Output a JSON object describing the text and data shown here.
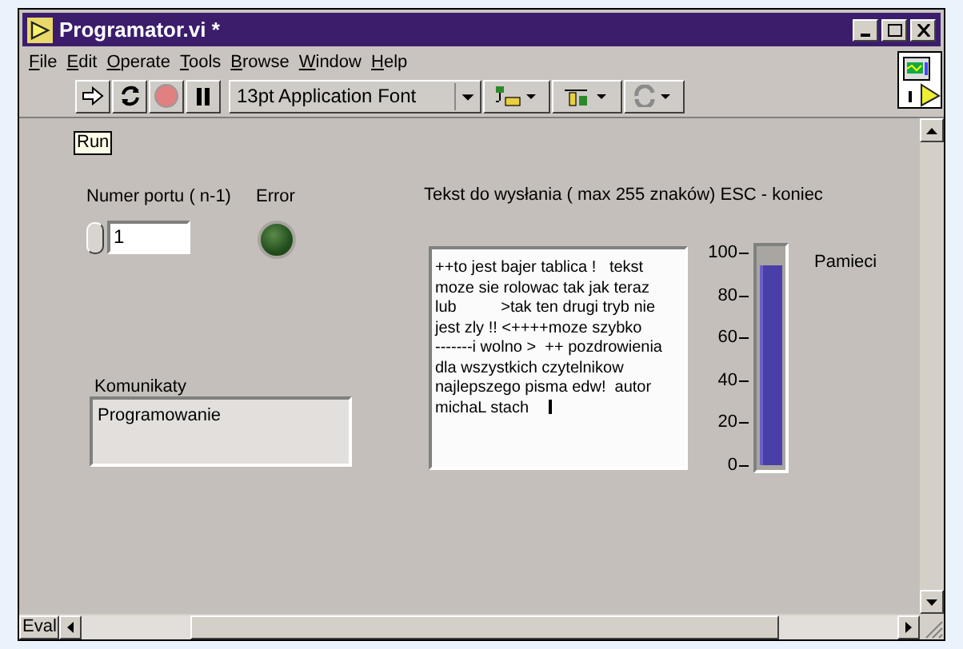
{
  "window": {
    "title": "Programator.vi *"
  },
  "menu": [
    {
      "label": "File"
    },
    {
      "label": "Edit"
    },
    {
      "label": "Operate"
    },
    {
      "label": "Tools"
    },
    {
      "label": "Browse"
    },
    {
      "label": "Window"
    },
    {
      "label": "Help"
    }
  ],
  "toolbar": {
    "font": "13pt Application Font",
    "abort_disabled": true
  },
  "panel": {
    "run_label": "Run",
    "port": {
      "label": "Numer portu ( n-1)",
      "value": "1"
    },
    "error": {
      "label": "Error",
      "on": false
    },
    "messages": {
      "label": "Komunikaty",
      "value": "Programowanie"
    },
    "text": {
      "label": "Tekst do wysłania ( max 255 znaków) ESC - koniec",
      "lines": [
        "++to jest bajer tablica !   tekst",
        "moze sie rolowac tak jak teraz",
        "lub          >tak ten drugi tryb nie",
        "jest zly !! <++++moze szybko",
        "-------i wolno >  ++ pozdrowienia",
        "dla wszystkich czytelnikow",
        "najlepszego pisma edw!  autor",
        "michaL stach"
      ]
    },
    "memory": {
      "label": "Pamieci",
      "level": 0.95,
      "ticks": [
        "100",
        "80",
        "60",
        "40",
        "20",
        "0"
      ]
    }
  },
  "status_bar": {
    "mode": "Eval"
  }
}
